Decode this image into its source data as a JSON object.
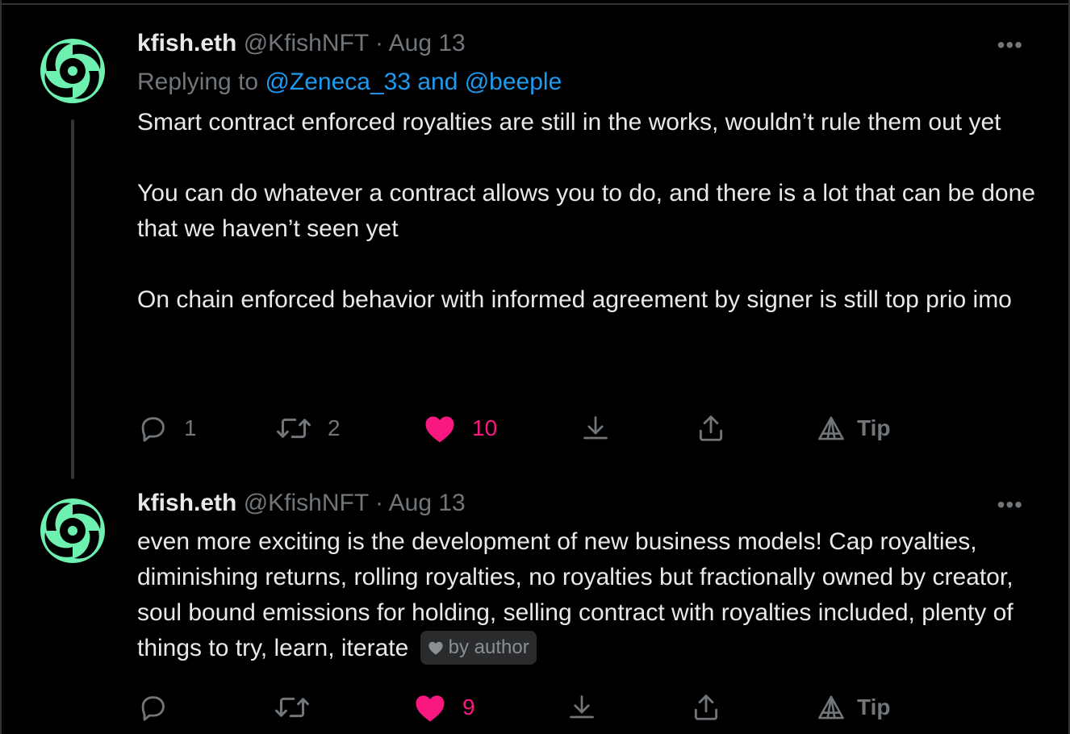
{
  "tweets": [
    {
      "name": "kfish.eth",
      "handle": "@KfishNFT",
      "separator": "·",
      "date": "Aug 13",
      "reply_prefix": "Replying to ",
      "reply_mentions": "@Zeneca_33 and @beeple",
      "paragraphs": [
        "Smart contract enforced royalties are still in the works, wouldn’t rule them out yet",
        "You can do whatever a contract allows you to do, and there is a lot that can be done that we haven’t seen yet",
        "On chain enforced behavior with informed agreement by signer is still top prio imo"
      ],
      "replies": "1",
      "retweets": "2",
      "likes": "10",
      "tip_label": "Tip",
      "more_label": "•••"
    },
    {
      "name": "kfish.eth",
      "handle": "@KfishNFT",
      "separator": "·",
      "date": "Aug 13",
      "body": "even more exciting is the development of new business models! Cap royalties, diminishing returns, rolling royalties, no royalties but fractionally owned by creator, soul bound emissions for holding, selling contract with royalties included, plenty of things to try, learn, iterate",
      "badge": "by author",
      "replies": "",
      "retweets": "",
      "likes": "9",
      "tip_label": "Tip",
      "more_label": "•••"
    }
  ],
  "colors": {
    "background": "#000000",
    "text": "#e7e9ea",
    "secondary": "#71767b",
    "link": "#1d9bf0",
    "like": "#f91880",
    "avatar": "#6ef0b0"
  },
  "icons": [
    "avatar-logo-icon",
    "more-icon",
    "reply-icon",
    "retweet-icon",
    "heart-icon",
    "bookmark-icon",
    "share-icon",
    "tip-icon",
    "small-heart-icon"
  ]
}
